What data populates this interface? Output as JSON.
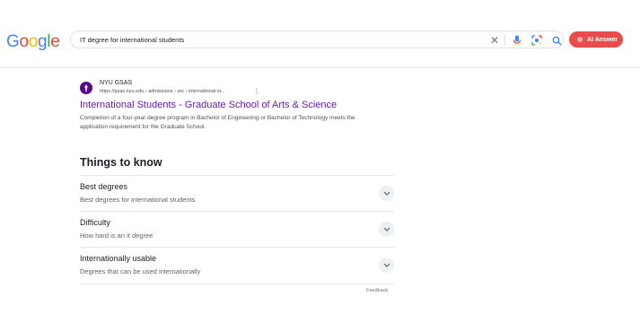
{
  "logo": {
    "text": "Google"
  },
  "search": {
    "query": "IT degree for international students",
    "icons": [
      "close-icon",
      "mic-icon",
      "lens-icon",
      "search-icon"
    ]
  },
  "ai_answer": {
    "label": "AI Answer",
    "color": "#e94d49"
  },
  "result": {
    "site_name": "NYU GSAS",
    "url": "https://gsas.nyu.edu › admissions › arc › international-st...",
    "title": "International Students - Graduate School of Arts & Science",
    "snippet": "Completion of a four-year degree program in Bachelor of Engineering or Bachelor of Technology meets the application requirement for the Graduate School.",
    "title_color": "#681da8",
    "favicon_color": "#57068c"
  },
  "things_to_know": {
    "heading": "Things to know",
    "items": [
      {
        "title": "Best degrees",
        "subtitle": "Best degrees for international students"
      },
      {
        "title": "Difficulty",
        "subtitle": "How hard is an it degree"
      },
      {
        "title": "Internationally usable",
        "subtitle": "Degrees that can be used internationally"
      }
    ],
    "feedback": "Feedback"
  }
}
